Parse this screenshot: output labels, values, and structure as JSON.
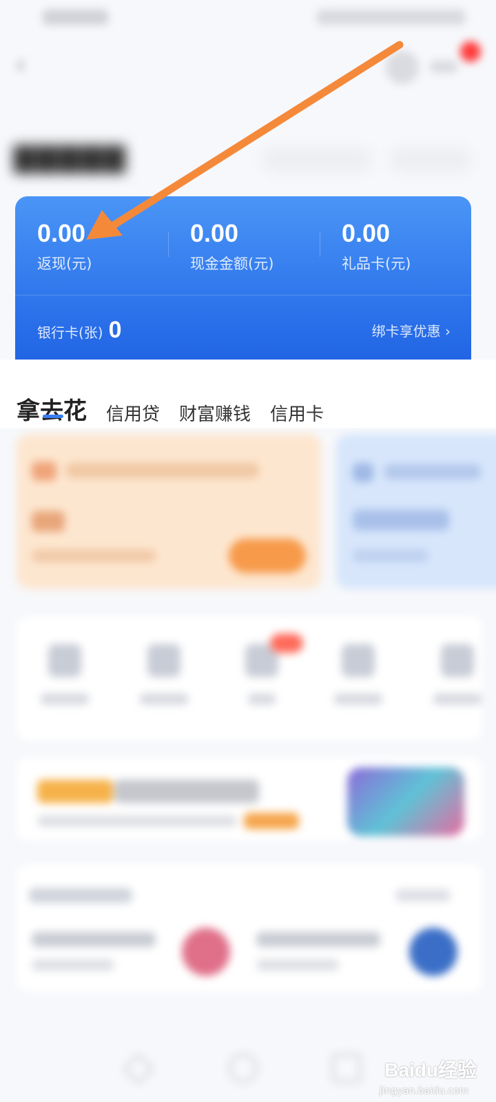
{
  "card": {
    "cashback": {
      "value": "0.00",
      "label": "返现(元)"
    },
    "cash": {
      "value": "0.00",
      "label": "现金金额(元)"
    },
    "gift": {
      "value": "0.00",
      "label": "礼品卡(元)"
    },
    "bank_label": "银行卡(张)",
    "bank_count": "0",
    "bind_link": "绑卡享优惠 ›"
  },
  "tabs": [
    {
      "label": "拿去花",
      "active": true
    },
    {
      "label": "信用贷",
      "active": false
    },
    {
      "label": "财富赚钱",
      "active": false
    },
    {
      "label": "信用卡",
      "active": false
    }
  ],
  "colors": {
    "card_blue": "#2f76ec",
    "accent_blue": "#3a7df2",
    "arrow_orange": "#f5893a",
    "product_orange": "#fde6cf",
    "product_blue": "#d7e6fb"
  },
  "watermark": {
    "brand": "Baidu经验",
    "url": "jingyan.baidu.com"
  }
}
